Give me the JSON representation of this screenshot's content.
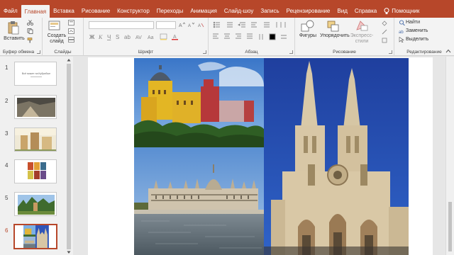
{
  "menu": {
    "tabs": [
      "Файл",
      "Главная",
      "Вставка",
      "Рисование",
      "Конструктор",
      "Переходы",
      "Анимация",
      "Слайд-шоу",
      "Запись",
      "Рецензирование",
      "Вид",
      "Справка"
    ],
    "active_index": 1,
    "help_label": "Помощник"
  },
  "ribbon": {
    "clipboard": {
      "paste_label": "Вставить",
      "group_label": "Буфер обмена"
    },
    "slides": {
      "new_slide_label_1": "Создать",
      "new_slide_label_2": "слайд",
      "group_label": "Слайды"
    },
    "font": {
      "group_label": "Шрифт"
    },
    "paragraph": {
      "group_label": "Абзац"
    },
    "drawing": {
      "shapes_label": "Фигуры",
      "arrange_label": "Упорядочить",
      "styles_label_1": "Экспресс-",
      "styles_label_2": "стили",
      "group_label": "Рисование"
    },
    "editing": {
      "find_label": "Найти",
      "replace_label": "Заменить",
      "select_label": "Выделить",
      "group_label": "Редактирование"
    }
  },
  "slides": [
    {
      "number": "1",
      "title_text": "Всё может на Кубрибые"
    },
    {
      "number": "2"
    },
    {
      "number": "3"
    },
    {
      "number": "4"
    },
    {
      "number": "5"
    },
    {
      "number": "6"
    }
  ],
  "selected_slide": 6,
  "colors": {
    "accent": "#b7472a",
    "ribbon_bg": "#f3f3f3",
    "sky": "#3f72c2",
    "stone": "#d8c7a6"
  }
}
